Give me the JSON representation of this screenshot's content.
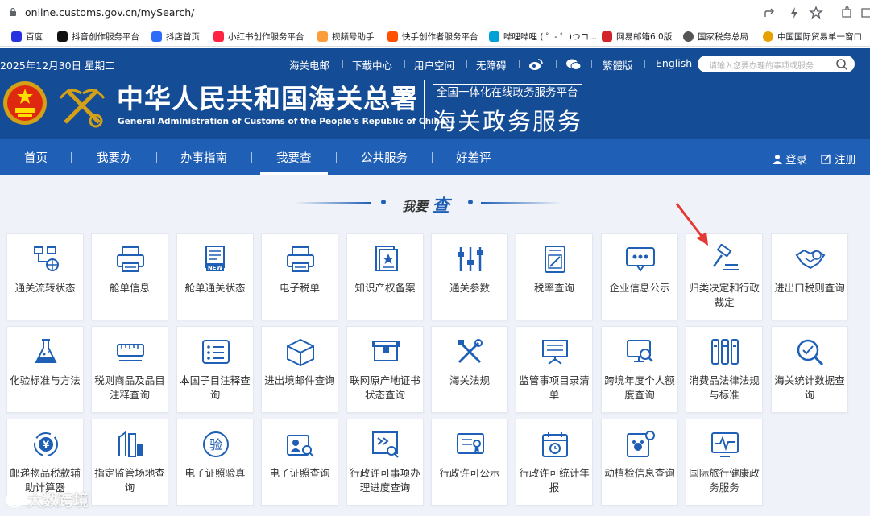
{
  "browser": {
    "url": "online.customs.gov.cn/mySearch/",
    "bookmarks": [
      {
        "label": "百度",
        "color": "#2932e1"
      },
      {
        "label": "抖音创作服务平台",
        "color": "#111111"
      },
      {
        "label": "抖店首页",
        "color": "#2d6cf6"
      },
      {
        "label": "小红书创作服务平台",
        "color": "#ff2442"
      },
      {
        "label": "视频号助手",
        "color": "#fa9d3b"
      },
      {
        "label": "快手创作者服务平台",
        "color": "#ff5000"
      },
      {
        "label": "哔哩哔哩 ( ゜- ゜)つロ...",
        "color": "#00a1d6"
      },
      {
        "label": "网易邮箱6.0版",
        "color": "#d3232b"
      },
      {
        "label": "国家税务总局",
        "color": "#555555"
      },
      {
        "label": "中国国际贸易单一窗口",
        "color": "#e6a100"
      }
    ]
  },
  "header": {
    "date": "2025年12月30日 星期二",
    "links": [
      "海关电邮",
      "下载中心",
      "用户空间",
      "无障碍"
    ],
    "lang_links": [
      "繁體版",
      "English"
    ],
    "search_placeholder": "请输入您要办理的事项或服务",
    "title_cn": "中华人民共和国海关总署",
    "title_en": "General Administration of Customs of the People's Republic of China",
    "platform": "全国一体化在线政务服务平台",
    "service": "海关政务服务"
  },
  "nav": {
    "items": [
      "首页",
      "我要办",
      "办事指南",
      "我要查",
      "公共服务",
      "好差评"
    ],
    "active": "我要查",
    "login": "登录",
    "register": "注册"
  },
  "section": {
    "title_a": "我要",
    "title_b": "查"
  },
  "cards": [
    {
      "label": "通关流转状态",
      "icon": "flow-status-icon"
    },
    {
      "label": "舱单信息",
      "icon": "manifest-printer-icon"
    },
    {
      "label": "舱单通关状态",
      "icon": "manifest-new-icon"
    },
    {
      "label": "电子税单",
      "icon": "tax-printer-icon"
    },
    {
      "label": "知识产权备案",
      "icon": "ip-record-icon"
    },
    {
      "label": "通关参数",
      "icon": "sliders-icon"
    },
    {
      "label": "税率查询",
      "icon": "tax-rate-icon"
    },
    {
      "label": "企业信息公示",
      "icon": "enterprise-info-icon"
    },
    {
      "label": "归类决定和行政裁定",
      "icon": "gavel-icon"
    },
    {
      "label": "进出口税则查询",
      "icon": "handshake-icon"
    },
    {
      "label": "化验标准与方法",
      "icon": "flask-icon"
    },
    {
      "label": "税则商品及品目注释查询",
      "icon": "ruler-icon"
    },
    {
      "label": "本国子目注释查询",
      "icon": "list-icon"
    },
    {
      "label": "进出境邮件查询",
      "icon": "package-icon"
    },
    {
      "label": "联网原产地证书状态查询",
      "icon": "certificate-box-icon"
    },
    {
      "label": "海关法规",
      "icon": "tools-icon"
    },
    {
      "label": "监管事项目录清单",
      "icon": "board-icon"
    },
    {
      "label": "跨境年度个人额度查询",
      "icon": "monitor-search-icon"
    },
    {
      "label": "消费品法律法规与标准",
      "icon": "books-icon"
    },
    {
      "label": "海关统计数据查询",
      "icon": "stats-search-icon"
    },
    {
      "label": "邮递物品税款辅助计算器",
      "icon": "yuan-cycle-icon"
    },
    {
      "label": "指定监管场地查询",
      "icon": "site-icon"
    },
    {
      "label": "电子证照验真",
      "icon": "verify-icon"
    },
    {
      "label": "电子证照查询",
      "icon": "id-search-icon"
    },
    {
      "label": "行政许可事项办理进度查询",
      "icon": "progress-icon"
    },
    {
      "label": "行政许可公示",
      "icon": "license-icon"
    },
    {
      "label": "行政许可统计年报",
      "icon": "calendar-icon"
    },
    {
      "label": "动植检信息查询",
      "icon": "plant-info-icon"
    },
    {
      "label": "国际旅行健康政务服务",
      "icon": "health-monitor-icon"
    }
  ],
  "watermark": "大数跨境"
}
